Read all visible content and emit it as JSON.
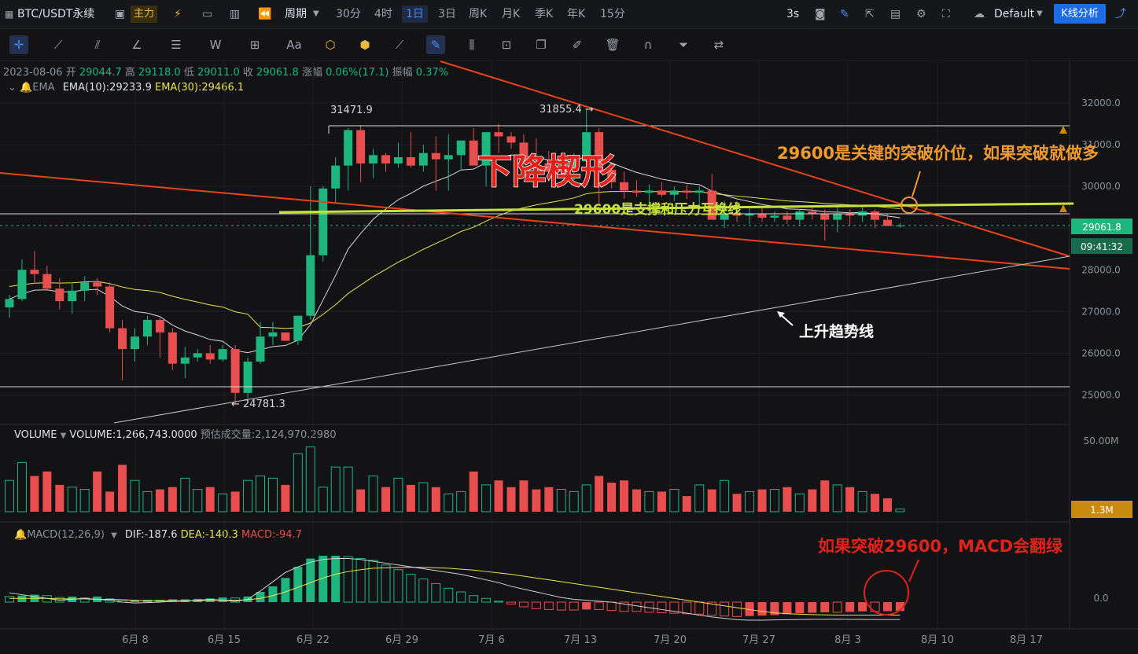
{
  "toolbar": {
    "symbol": "BTC/USDT永续",
    "main_label": "主力",
    "period_label": "周期",
    "intervals": [
      "30分",
      "4时",
      "1日",
      "3日",
      "周K",
      "月K",
      "季K",
      "年K",
      "15分"
    ],
    "active_interval": "1日",
    "refresh": "3s",
    "theme": "Default",
    "analysis_button": "K线分析"
  },
  "ohlc": {
    "date": "2023-08-06",
    "open_label": "开",
    "open": "29044.7",
    "high_label": "高",
    "high": "29118.0",
    "low_label": "低",
    "low": "29011.0",
    "close_label": "收",
    "close": "29061.8",
    "change_label": "涨幅",
    "change": "0.06%(17.1)",
    "amp_label": "振幅",
    "amp": "0.37%"
  },
  "ema": {
    "name": "EMA",
    "ema10": "EMA(10):29233.9",
    "ema30": "EMA(30):29466.1"
  },
  "volume_info": {
    "name": "VOLUME",
    "value": "VOLUME:1,266,743.0000",
    "forecast": "预估成交量:2,124,970.2980"
  },
  "macd_info": {
    "name": "MACD(12,26,9)",
    "dif": "DIF:-187.6",
    "dea": "DEA:-140.3",
    "macd": "MACD:-94.7"
  },
  "annotations": {
    "wedge": "下降楔形",
    "breakout": "29600是关键的突破价位，如果突破就做多",
    "support": "29600是支撑和压力互换线",
    "uptrend": "上升趋势线",
    "macd_note": "如果突破29600，MACD会翻绿",
    "high1": "31471.9",
    "high2": "31855.4",
    "low1": "24781.3"
  },
  "price_tags": {
    "last": "29061.8",
    "countdown": "09:41:32",
    "vol_last": "1.3M"
  },
  "colors": {
    "up": "#1fb57f",
    "down": "#e84e4e",
    "ema10": "#d8d8d8",
    "ema30": "#e7e44e",
    "trend": "#e8431a",
    "support": "#c6e23a",
    "accent": "#1e6be6"
  },
  "chart_data": {
    "type": "candlestick",
    "price_axis": {
      "ticks": [
        32000,
        31000,
        30000,
        29000,
        28000,
        27000,
        26000,
        25000
      ],
      "tick_labels": [
        "32000.0",
        "31000.0",
        "30000.0",
        "29000.0",
        "28000.0",
        "27000.0",
        "26000.0",
        "25000.0"
      ]
    },
    "volume_axis": {
      "tick_label": "50.00M"
    },
    "macd_axis": {
      "tick_label": "0.0"
    },
    "x_labels": [
      "6月 8",
      "6月 15",
      "6月 22",
      "6月 29",
      "7月 6",
      "7月 13",
      "7月 20",
      "7月 27",
      "8月 3",
      "8月 10",
      "8月 17"
    ],
    "first_date": "2023-05-31",
    "candles": [
      [
        27100,
        27400,
        26850,
        27300
      ],
      [
        27300,
        28250,
        27250,
        28000
      ],
      [
        28000,
        28450,
        27700,
        27900
      ],
      [
        27900,
        28100,
        27500,
        27550
      ],
      [
        27550,
        27800,
        27050,
        27250
      ],
      [
        27250,
        27700,
        26950,
        27500
      ],
      [
        27500,
        27850,
        27250,
        27700
      ],
      [
        27700,
        27800,
        27400,
        27600
      ],
      [
        27600,
        27700,
        26500,
        26600
      ],
      [
        26600,
        26800,
        25350,
        26100
      ],
      [
        26100,
        26600,
        25800,
        26400
      ],
      [
        26400,
        26900,
        26200,
        26800
      ],
      [
        26800,
        26850,
        25900,
        26500
      ],
      [
        26500,
        26600,
        25600,
        25750
      ],
      [
        25750,
        26150,
        25400,
        25900
      ],
      [
        25900,
        26100,
        25800,
        26000
      ],
      [
        26000,
        26200,
        25750,
        25850
      ],
      [
        25850,
        26200,
        25800,
        26100
      ],
      [
        26100,
        26200,
        24781,
        25050
      ],
      [
        25050,
        25900,
        24900,
        25800
      ],
      [
        25800,
        26750,
        25750,
        26400
      ],
      [
        26400,
        26750,
        26200,
        26500
      ],
      [
        26500,
        26500,
        26300,
        26300
      ],
      [
        26300,
        26900,
        26200,
        26900
      ],
      [
        26900,
        30000,
        26800,
        28350
      ],
      [
        28350,
        30000,
        28200,
        29950
      ],
      [
        29950,
        30700,
        29600,
        30500
      ],
      [
        30500,
        31400,
        29900,
        31350
      ],
      [
        31350,
        31472,
        30100,
        30550
      ],
      [
        30550,
        30900,
        30200,
        30750
      ],
      [
        30750,
        30800,
        30350,
        30550
      ],
      [
        30550,
        31050,
        30450,
        30700
      ],
      [
        30700,
        31300,
        30450,
        30500
      ],
      [
        30500,
        31000,
        30350,
        30800
      ],
      [
        30800,
        31200,
        29900,
        30650
      ],
      [
        30650,
        31250,
        29900,
        30750
      ],
      [
        30750,
        31100,
        30400,
        31100
      ],
      [
        31100,
        31400,
        30550,
        30500
      ],
      [
        30500,
        31100,
        30000,
        31300
      ],
      [
        31300,
        31500,
        30800,
        31200
      ],
      [
        31200,
        31300,
        30900,
        31050
      ],
      [
        31050,
        31250,
        30400,
        30600
      ],
      [
        30600,
        31150,
        30200,
        30550
      ],
      [
        30550,
        30850,
        30300,
        30350
      ],
      [
        30350,
        30650,
        30200,
        30450
      ],
      [
        30450,
        30800,
        30150,
        30600
      ],
      [
        30600,
        31855,
        30300,
        31300
      ],
      [
        31300,
        31400,
        29550,
        30400
      ],
      [
        30400,
        30550,
        29950,
        30100
      ],
      [
        30100,
        30350,
        29700,
        29900
      ],
      [
        29900,
        30150,
        29750,
        29850
      ],
      [
        29850,
        30050,
        29600,
        29900
      ],
      [
        29900,
        30100,
        29750,
        29800
      ],
      [
        29800,
        30000,
        29650,
        29900
      ],
      [
        29900,
        30050,
        29700,
        29850
      ],
      [
        29850,
        30000,
        29450,
        29900
      ],
      [
        29900,
        30300,
        29500,
        29200
      ],
      [
        29200,
        29650,
        29000,
        29350
      ],
      [
        29350,
        29650,
        29150,
        29300
      ],
      [
        29300,
        29500,
        29100,
        29350
      ],
      [
        29350,
        29500,
        29150,
        29250
      ],
      [
        29250,
        29400,
        29150,
        29300
      ],
      [
        29300,
        29400,
        29100,
        29200
      ],
      [
        29200,
        29450,
        29050,
        29400
      ],
      [
        29400,
        29550,
        29200,
        29350
      ],
      [
        29350,
        29450,
        28700,
        29200
      ],
      [
        29200,
        29550,
        28900,
        29350
      ],
      [
        29350,
        29450,
        29050,
        29300
      ],
      [
        29300,
        29500,
        29150,
        29400
      ],
      [
        29400,
        29450,
        29000,
        29200
      ],
      [
        29200,
        29350,
        29150,
        29050
      ],
      [
        29050,
        29120,
        29011,
        29062
      ]
    ],
    "volume": [
      0.7,
      1.1,
      0.8,
      0.9,
      0.6,
      0.55,
      0.5,
      0.9,
      0.45,
      1.05,
      0.7,
      0.45,
      0.5,
      0.55,
      0.75,
      0.5,
      0.55,
      0.4,
      0.45,
      0.7,
      0.8,
      0.75,
      0.6,
      1.3,
      1.45,
      0.55,
      1.0,
      1.0,
      0.5,
      0.8,
      0.55,
      0.75,
      0.6,
      0.65,
      0.55,
      0.4,
      0.45,
      0.9,
      0.6,
      0.7,
      0.55,
      0.7,
      0.5,
      0.55,
      0.5,
      0.45,
      0.6,
      0.8,
      0.65,
      0.7,
      0.5,
      0.45,
      0.45,
      0.5,
      0.35,
      0.6,
      0.5,
      0.7,
      0.4,
      0.45,
      0.5,
      0.5,
      0.55,
      0.4,
      0.5,
      0.7,
      0.6,
      0.55,
      0.45,
      0.4,
      0.3,
      0.06
    ],
    "macd_hist": [
      60,
      70,
      80,
      70,
      50,
      60,
      45,
      60,
      35,
      20,
      20,
      25,
      25,
      30,
      30,
      35,
      40,
      50,
      45,
      60,
      110,
      170,
      260,
      380,
      470,
      500,
      500,
      490,
      470,
      450,
      400,
      350,
      300,
      250,
      200,
      150,
      110,
      70,
      40,
      10,
      -20,
      -50,
      -70,
      -80,
      -85,
      -85,
      -80,
      -80,
      -90,
      -100,
      -100,
      -110,
      -115,
      -120,
      -125,
      -130,
      -140,
      -150,
      -155,
      -150,
      -145,
      -140,
      -130,
      -120,
      -115,
      -110,
      -110,
      -105,
      -100,
      -100,
      -98,
      -95
    ],
    "macd_dif": [
      100,
      80,
      60,
      40,
      20,
      30,
      40,
      30,
      20,
      0,
      -10,
      -5,
      0,
      10,
      10,
      20,
      30,
      20,
      10,
      30,
      120,
      220,
      320,
      380,
      430,
      460,
      470,
      470,
      460,
      440,
      420,
      400,
      380,
      360,
      340,
      320,
      300,
      270,
      240,
      210,
      170,
      140,
      110,
      80,
      50,
      30,
      20,
      10,
      0,
      -20,
      -40,
      -60,
      -80,
      -100,
      -120,
      -140,
      -160,
      -175,
      -190,
      -195,
      -195,
      -192,
      -190,
      -188,
      -185,
      -185,
      -183,
      -185,
      -186,
      -187,
      -188,
      -187.6
    ],
    "macd_dea": [
      40,
      40,
      40,
      40,
      35,
      35,
      35,
      30,
      30,
      25,
      20,
      15,
      15,
      15,
      15,
      15,
      20,
      20,
      20,
      25,
      40,
      70,
      110,
      160,
      210,
      260,
      300,
      330,
      350,
      365,
      370,
      375,
      375,
      375,
      370,
      365,
      355,
      345,
      330,
      315,
      300,
      280,
      260,
      240,
      220,
      200,
      180,
      160,
      140,
      120,
      100,
      80,
      60,
      40,
      20,
      0,
      -20,
      -40,
      -60,
      -80,
      -100,
      -115,
      -125,
      -130,
      -135,
      -138,
      -140,
      -140,
      -140,
      -140,
      -140,
      -140.3
    ]
  }
}
